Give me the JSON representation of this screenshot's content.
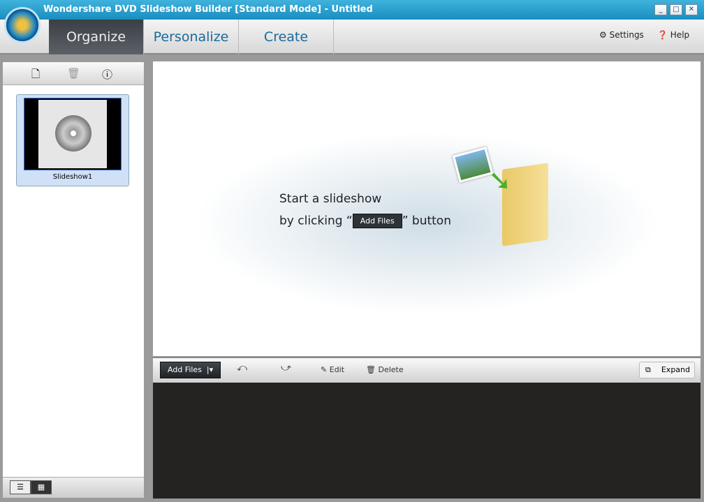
{
  "window": {
    "title": "Wondershare DVD Slideshow Builder [Standard Mode] - Untitled"
  },
  "nav": {
    "tabs": [
      "Organize",
      "Personalize",
      "Create"
    ],
    "settings": "Settings",
    "help": "Help"
  },
  "sidebar": {
    "slideshow_label": "Slideshow1"
  },
  "stage": {
    "line1": "Start a slideshow",
    "line2_prefix": "by clicking “",
    "line2_button": "Add Files",
    "line2_suffix": "”  button"
  },
  "toolbar": {
    "add_files": "Add Files",
    "edit": "Edit",
    "delete": "Delete",
    "expand": "Expand"
  }
}
